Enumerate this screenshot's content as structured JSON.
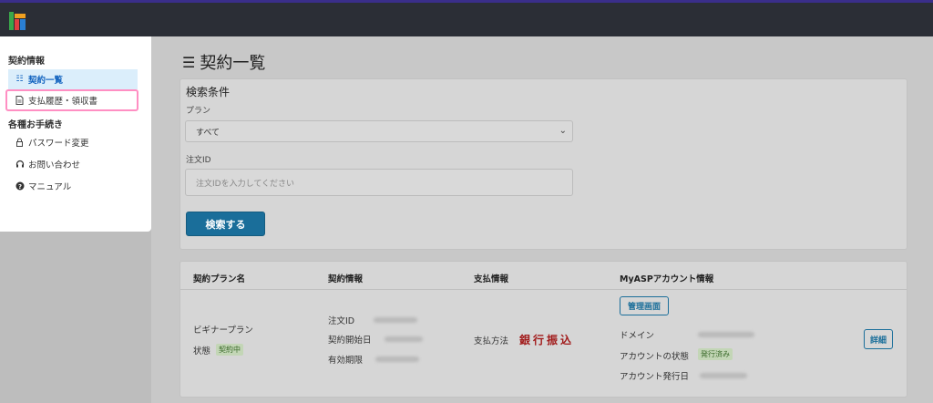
{
  "sidebar": {
    "section_contract": "契約情報",
    "items_contract": [
      {
        "label": "契約一覧",
        "icon": "list-icon"
      },
      {
        "label": "支払履歴・領収書",
        "icon": "document-icon"
      }
    ],
    "section_procedures": "各種お手続き",
    "items_procedures": [
      {
        "label": "パスワード変更",
        "icon": "lock-icon"
      },
      {
        "label": "お問い合わせ",
        "icon": "headset-icon"
      },
      {
        "label": "マニュアル",
        "icon": "question-circle-icon"
      }
    ]
  },
  "main": {
    "title": "契約一覧",
    "search": {
      "title": "検索条件",
      "plan_label": "プラン",
      "plan_value": "すべて",
      "order_label": "注文ID",
      "order_placeholder": "注文IDを入力してください",
      "submit_label": "検索する"
    },
    "table": {
      "headers": [
        "契約プラン名",
        "契約情報",
        "支払情報",
        "MyASPアカウント情報"
      ],
      "row": {
        "plan_name": "ビギナープラン",
        "status_label": "状態",
        "status_badge": "契約中",
        "order_id_label": "注文ID",
        "start_date_label": "契約開始日",
        "expiry_label": "有効期限",
        "payment_method_label": "支払方法",
        "payment_method_value": "銀行振込",
        "admin_button": "管理画面",
        "domain_label": "ドメイン",
        "account_status_label": "アカウントの状態",
        "account_status_badge": "発行済み",
        "issued_date_label": "アカウント発行日",
        "detail_button": "詳細"
      }
    }
  },
  "colors": {
    "topbar": "#2b2e36",
    "primary_button": "#1a6e9a",
    "highlight_border": "#ff8fc3",
    "bank_transfer": "#a11a1a"
  }
}
